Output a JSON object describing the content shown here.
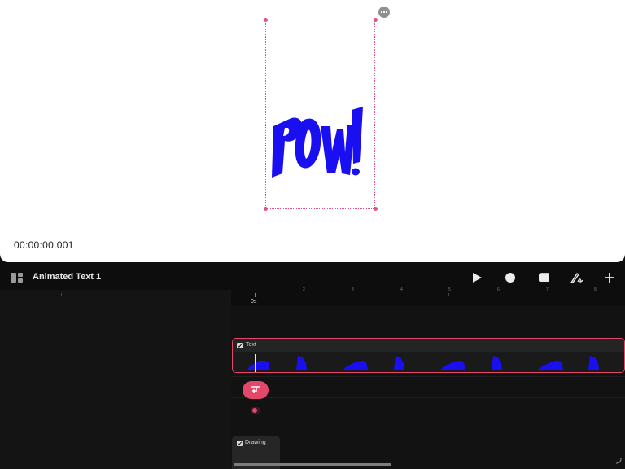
{
  "canvas": {
    "timecode": "00:00:00.001",
    "artwork_text": "POW!",
    "artwork_color": "#1a0ff0"
  },
  "toolbar": {
    "title": "Animated Text 1",
    "buttons": [
      "layers-icon",
      "play-icon",
      "record-icon",
      "camera-icon",
      "pen-icon",
      "plus-icon"
    ]
  },
  "timeline": {
    "ruler_labels": [
      "2",
      "3",
      "4",
      "5",
      "6",
      "7",
      "8"
    ],
    "playhead_label": "0s",
    "tracks": [
      {
        "label": "Text",
        "selected": true
      },
      {
        "label": "Drawing",
        "selected": false
      }
    ],
    "accent_color": "#e3476a"
  }
}
